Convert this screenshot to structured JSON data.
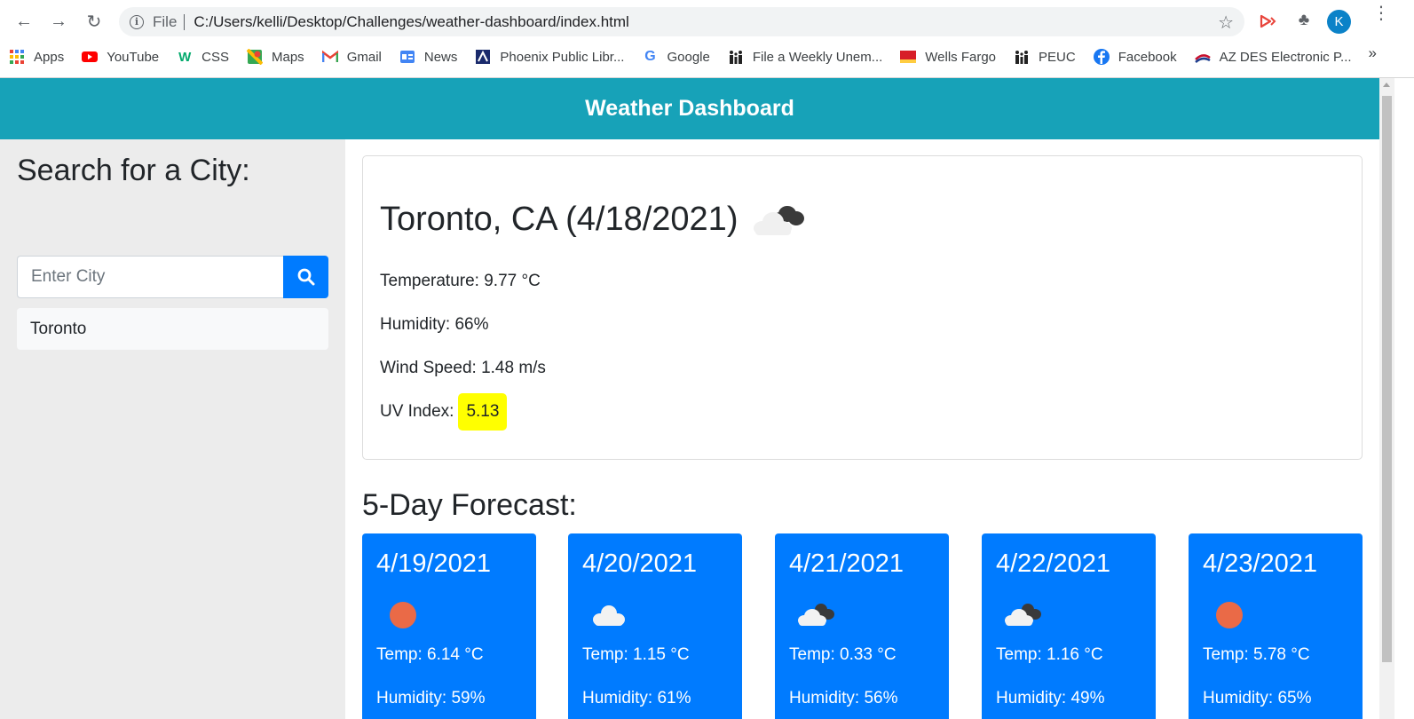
{
  "browser": {
    "scheme": "File",
    "url": "C:/Users/kelli/Desktop/Challenges/weather-dashboard/index.html",
    "avatar_letter": "K",
    "bookmarks": [
      {
        "label": "Apps",
        "icon": "apps-grid-icon"
      },
      {
        "label": "YouTube",
        "icon": "youtube-icon"
      },
      {
        "label": "CSS",
        "icon": "w3-icon"
      },
      {
        "label": "Maps",
        "icon": "maps-icon"
      },
      {
        "label": "Gmail",
        "icon": "gmail-icon"
      },
      {
        "label": "News",
        "icon": "google-news-icon"
      },
      {
        "label": "Phoenix Public Libr...",
        "icon": "library-icon"
      },
      {
        "label": "Google",
        "icon": "google-icon"
      },
      {
        "label": "File a Weekly Unem...",
        "icon": "family-icon"
      },
      {
        "label": "Wells Fargo",
        "icon": "wells-fargo-icon"
      },
      {
        "label": "PEUC",
        "icon": "family-icon"
      },
      {
        "label": "Facebook",
        "icon": "facebook-icon"
      },
      {
        "label": "AZ DES Electronic P...",
        "icon": "az-des-icon"
      }
    ],
    "more_label": "»"
  },
  "header": {
    "title": "Weather Dashboard"
  },
  "sidebar": {
    "title": "Search for a City:",
    "search_placeholder": "Enter City",
    "history": [
      "Toronto"
    ]
  },
  "current": {
    "title": "Toronto, CA (4/18/2021)",
    "icon": "broken-clouds-icon",
    "temperature": "Temperature: 9.77 °C",
    "humidity": "Humidity: 66%",
    "wind": "Wind Speed: 1.48 m/s",
    "uv_label": "UV Index:",
    "uv_value": "5.13",
    "uv_color": "#ffff00"
  },
  "forecast": {
    "title": "5-Day Forecast:",
    "days": [
      {
        "date": "4/19/2021",
        "icon": "clear-sun-icon",
        "temp": "Temp: 6.14 °C",
        "humidity": "Humidity: 59%"
      },
      {
        "date": "4/20/2021",
        "icon": "cloud-icon",
        "temp": "Temp: 1.15 °C",
        "humidity": "Humidity: 61%"
      },
      {
        "date": "4/21/2021",
        "icon": "broken-clouds-icon",
        "temp": "Temp: 0.33 °C",
        "humidity": "Humidity: 56%"
      },
      {
        "date": "4/22/2021",
        "icon": "broken-clouds-icon",
        "temp": "Temp: 1.16 °C",
        "humidity": "Humidity: 49%"
      },
      {
        "date": "4/23/2021",
        "icon": "clear-sun-icon",
        "temp": "Temp: 5.78 °C",
        "humidity": "Humidity: 65%"
      }
    ]
  },
  "colors": {
    "banner": "#17a2b8",
    "primary": "#007bff",
    "sidebar": "#ececec"
  }
}
